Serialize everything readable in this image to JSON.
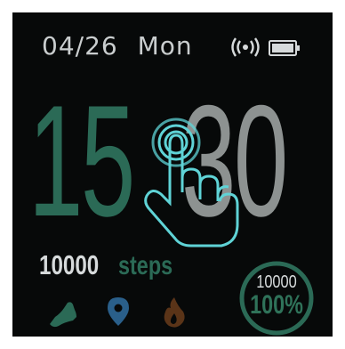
{
  "status": {
    "date": "04/26",
    "weekday": "Mon",
    "icons": [
      "vibrate-icon",
      "battery-icon"
    ]
  },
  "time": {
    "hours": "15",
    "minutes": "30"
  },
  "steps": {
    "count": "10000",
    "unit": "steps",
    "goal": "10000",
    "progress_percent": "100%",
    "progress_value": 1.0
  },
  "bottom_icons": [
    "shoe-icon",
    "location-icon",
    "flame-icon"
  ],
  "overlay": {
    "icon": "tap-hand-icon"
  },
  "colors": {
    "background": "#070909",
    "accent_green": "#2b6a56",
    "minutes_gray": "#8d9291",
    "text_light": "#d6dadb",
    "hand_cyan": "#5fd3d6",
    "location_blue": "#2a5f8a",
    "flame_brown": "#5a3418"
  }
}
